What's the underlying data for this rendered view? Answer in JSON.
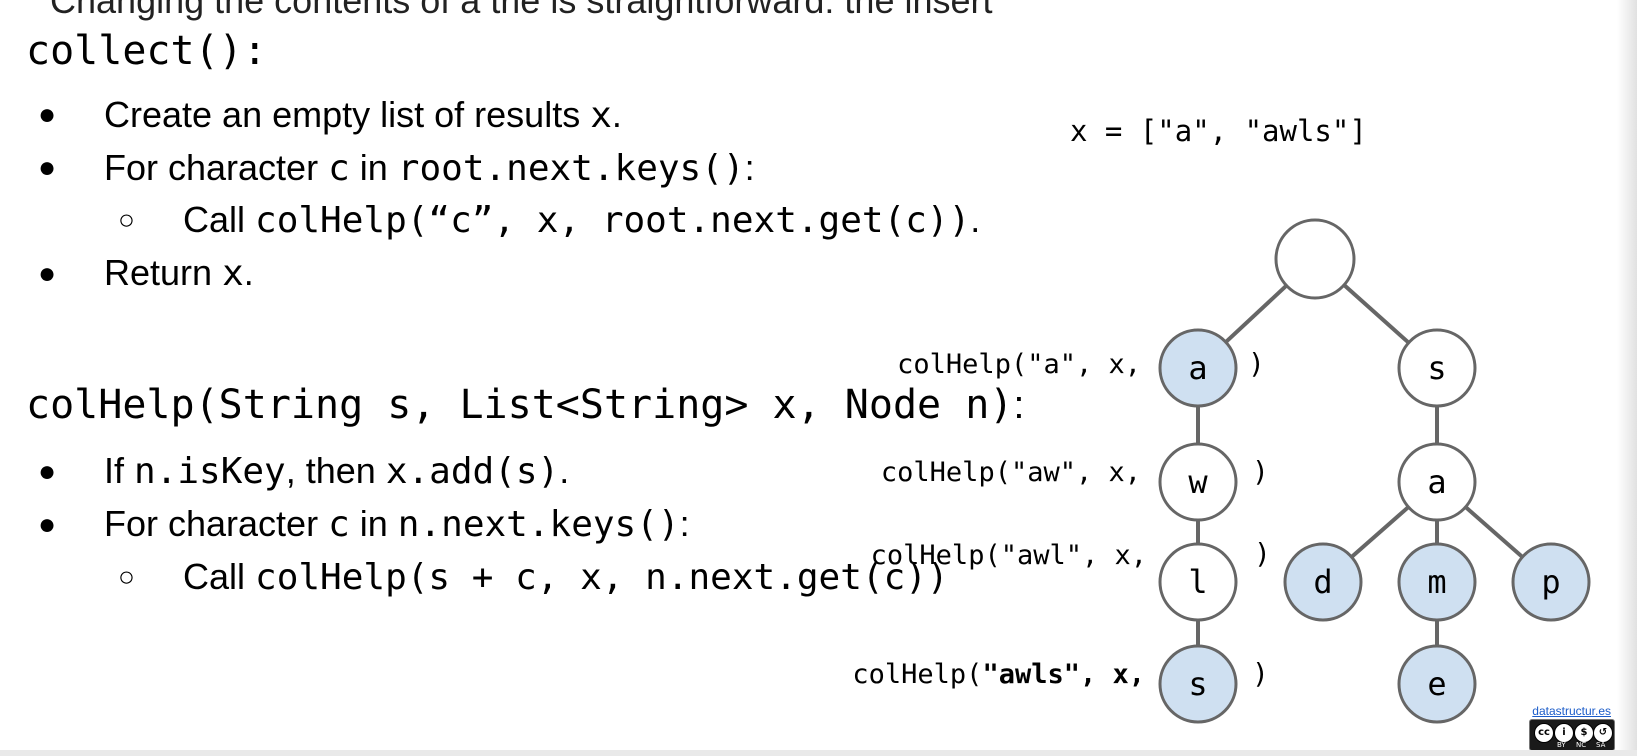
{
  "cutoff_text": "Changing the contents of a trie is straightforward: the insert",
  "collect": {
    "heading": "collect():",
    "bullets": {
      "b1_text": "Create an empty list of results ",
      "b1_var": "x",
      "b1_end": ".",
      "b2_text": "For character ",
      "b2_c": "c",
      "b2_in": " in ",
      "b2_code": "root.next.keys()",
      "b2_end": ":",
      "b3_text": "Call ",
      "b3_code": "colHelp(“c”, x, root.next.get(c))",
      "b3_end": ".",
      "b4_text": "Return ",
      "b4_var": "x",
      "b4_end": "."
    }
  },
  "colhelp": {
    "heading": "colHelp(String s, List<String> x, Node n)",
    "heading_end": ":",
    "bullets": {
      "b1_if": "If ",
      "b1_code": "n.isKey",
      "b1_then": ", then ",
      "b1_code2": "x.add(s)",
      "b1_end": ".",
      "b2_text": "For character ",
      "b2_c": "c",
      "b2_in": " in ",
      "b2_code": "n.next.keys()",
      "b2_end": ":",
      "b3_text": "Call ",
      "b3_code": "colHelp(s + c, x, n.next.get(c))"
    }
  },
  "result_list": "x = [\"a\", \"awls\"]",
  "calls": [
    {
      "prefix": "colHelp(\"a\", x, ",
      "close": ")",
      "bold": false
    },
    {
      "prefix": "colHelp(\"aw\", x, ",
      "close": ")",
      "bold": false
    },
    {
      "prefix": "colHelp(\"awl\", x, ",
      "close": ")",
      "bold": false
    },
    {
      "prefix": "colHelp(",
      "bold_part": "\"awls\", x, ",
      "close": ")",
      "bold": true
    }
  ],
  "tree": {
    "nodes": [
      {
        "id": "root",
        "label": "",
        "highlighted": false
      },
      {
        "id": "a",
        "label": "a",
        "highlighted": true
      },
      {
        "id": "s",
        "label": "s",
        "highlighted": false
      },
      {
        "id": "w",
        "label": "w",
        "highlighted": false
      },
      {
        "id": "a2",
        "label": "a",
        "highlighted": false
      },
      {
        "id": "l",
        "label": "l",
        "highlighted": false
      },
      {
        "id": "d",
        "label": "d",
        "highlighted": true
      },
      {
        "id": "m",
        "label": "m",
        "highlighted": true
      },
      {
        "id": "p",
        "label": "p",
        "highlighted": true
      },
      {
        "id": "s2",
        "label": "s",
        "highlighted": true
      },
      {
        "id": "e",
        "label": "e",
        "highlighted": true
      }
    ],
    "edges": [
      [
        "root",
        "a"
      ],
      [
        "root",
        "s"
      ],
      [
        "a",
        "w"
      ],
      [
        "w",
        "l"
      ],
      [
        "l",
        "s2"
      ],
      [
        "s",
        "a2"
      ],
      [
        "a2",
        "d"
      ],
      [
        "a2",
        "m"
      ],
      [
        "a2",
        "p"
      ],
      [
        "m",
        "e"
      ]
    ],
    "colors": {
      "highlight": "#cfe0f1",
      "plain": "#ffffff",
      "stroke": "#666666"
    }
  },
  "footer": {
    "link": "datastructur.es",
    "license": [
      "BY",
      "NC",
      "SA"
    ]
  }
}
